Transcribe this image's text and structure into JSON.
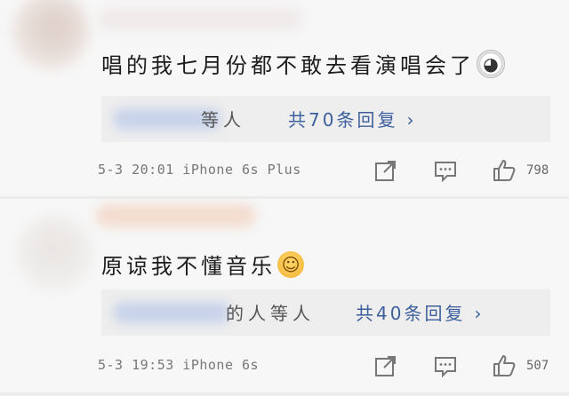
{
  "comments": [
    {
      "text": "唱的我七月份都不敢去看演唱会了",
      "emoji": "panda-emoji",
      "reply_people": "等人",
      "reply_link": "共70条回复",
      "timestamp": "5-3 20:01 iPhone 6s Plus",
      "likes": "798"
    },
    {
      "text": "原谅我不懂音乐",
      "emoji": "shrug-emoji",
      "reply_people": "的人等人",
      "reply_link": "共40条回复",
      "timestamp": "5-3 19:53 iPhone 6s",
      "likes": "507"
    }
  ],
  "icons": {
    "share": "share-icon",
    "comment": "comment-icon",
    "like": "thumbs-up-icon",
    "chevron": "chevron-right-icon"
  },
  "colors": {
    "link": "#3d5f9c",
    "background": "#f7f7f7",
    "reply_box": "#eeeeee"
  }
}
